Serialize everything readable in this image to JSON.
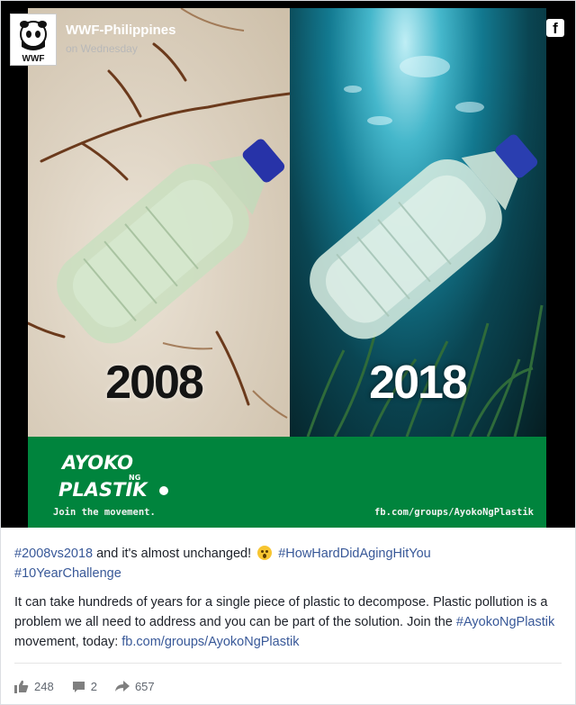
{
  "page": {
    "name": "WWF-Philippines",
    "time": "on Wednesday",
    "logo_text": "WWF",
    "platform_icon": "f"
  },
  "image": {
    "year_left": "2008",
    "year_right": "2018",
    "banner_join": "Join the movement.",
    "banner_url": "fb.com/groups/AyokoNgPlastik",
    "banner_logo_line1": "AYOKO",
    "banner_logo_ng": "NG",
    "banner_logo_line2": "PLASTIK"
  },
  "caption": {
    "line1_tag1": "#2008vs2018",
    "line1_text": " and it's almost unchanged! ",
    "line1_tag2": "#HowHardDidAgingHitYou",
    "line2_tag": "#10YearChallenge",
    "para2_text": "It can take hundreds of years for a single piece of plastic to decompose. Plastic pollution is a problem we all need to address and you can be part of the solution. Join the ",
    "para2_tag": "#AyokoNgPlastik",
    "para2_mid": " movement, today: ",
    "para2_link": "fb.com/groups/AyokoNgPlastik"
  },
  "stats": {
    "likes": "248",
    "comments": "2",
    "shares": "657"
  },
  "colors": {
    "link": "#385898",
    "banner_green": "#00843d",
    "text": "#1d2129",
    "muted": "#616770"
  },
  "icons": [
    "wwf-panda-logo",
    "facebook-icon",
    "surprised-emoji",
    "like-icon",
    "comment-icon",
    "share-icon"
  ]
}
